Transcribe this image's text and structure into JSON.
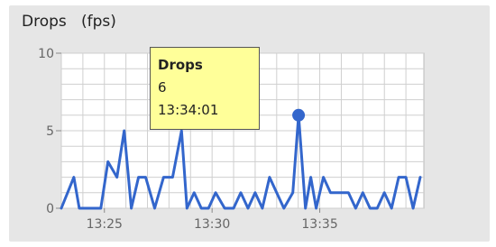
{
  "chart_data": {
    "type": "line",
    "title": "Drops",
    "unit": "(fps)",
    "ylim": [
      0,
      10
    ],
    "yticks": [
      0,
      5,
      10
    ],
    "x_range": [
      "13:23:00",
      "13:39:50"
    ],
    "xticks": [
      "13:25",
      "13:30",
      "13:35"
    ],
    "grid": true,
    "series": [
      {
        "name": "Drops",
        "color": "#3366cc",
        "x": [
          "13:23:00",
          "13:23:35",
          "13:23:50",
          "13:24:20",
          "13:24:50",
          "13:25:10",
          "13:25:35",
          "13:25:55",
          "13:26:15",
          "13:26:35",
          "13:26:55",
          "13:27:20",
          "13:27:45",
          "13:28:10",
          "13:28:35",
          "13:28:50",
          "13:29:10",
          "13:29:30",
          "13:29:50",
          "13:30:10",
          "13:30:35",
          "13:31:00",
          "13:31:20",
          "13:31:40",
          "13:32:00",
          "13:32:20",
          "13:32:40",
          "13:33:00",
          "13:33:20",
          "13:33:45",
          "13:34:01",
          "13:34:20",
          "13:34:35",
          "13:34:50",
          "13:35:10",
          "13:35:30",
          "13:36:00",
          "13:36:20",
          "13:36:40",
          "13:37:00",
          "13:37:20",
          "13:37:40",
          "13:38:00",
          "13:38:20",
          "13:38:40",
          "13:39:00",
          "13:39:20",
          "13:39:40"
        ],
        "y": [
          0,
          2,
          0,
          0,
          0,
          3,
          2,
          5,
          0,
          2,
          2,
          0,
          2,
          2,
          5,
          0,
          1,
          0,
          0,
          1,
          0,
          0,
          1,
          0,
          1,
          0,
          2,
          1,
          0,
          1,
          6,
          0,
          2,
          0,
          2,
          1,
          1,
          1,
          0,
          1,
          0,
          0,
          1,
          0,
          2,
          2,
          0,
          2
        ]
      }
    ],
    "highlight": {
      "series": "Drops",
      "value": "6",
      "time": "13:34:01"
    }
  },
  "colors": {
    "panel": "#e6e6e6",
    "plot_bg": "#ffffff",
    "grid": "#cfcfcf",
    "line": "#3366cc",
    "tooltip_bg": "#ffff99"
  }
}
